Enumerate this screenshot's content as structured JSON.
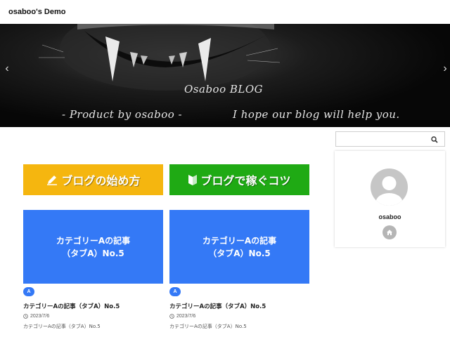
{
  "site": {
    "title": "osaboo's Demo"
  },
  "hero": {
    "title": "Osaboo BLOG",
    "subtitle_left": "- Product by osaboo -",
    "subtitle_right": "I hope our blog will help you.",
    "prev_arrow": "‹",
    "next_arrow": "›"
  },
  "banners": [
    {
      "label": "ブログの始め方",
      "icon": "pencil-icon",
      "color": "#f5b60f"
    },
    {
      "label": "ブログで稼ぐコツ",
      "icon": "beginner-mark-icon",
      "color": "#1faa14"
    }
  ],
  "posts": [
    {
      "thumb_line1": "カテゴリーAの記事",
      "thumb_line2": "（タブA）No.5",
      "category": "A",
      "title": "カテゴリーAの記事（タブA）No.5",
      "date": "2023/7/6",
      "excerpt": "カテゴリーAの記事（タブA）No.5"
    },
    {
      "thumb_line1": "カテゴリーAの記事",
      "thumb_line2": "（タブA）No.5",
      "category": "A",
      "title": "カテゴリーAの記事（タブA）No.5",
      "date": "2023/7/6",
      "excerpt": "カテゴリーAの記事（タブA）No.5"
    }
  ],
  "sidebar": {
    "search_placeholder": "",
    "search_icon": "search-icon",
    "profile": {
      "name": "osaboo",
      "home_icon": "home-icon"
    }
  },
  "colors": {
    "accent": "#3479f6",
    "banner_yellow": "#f5b60f",
    "banner_green": "#1faa14"
  }
}
